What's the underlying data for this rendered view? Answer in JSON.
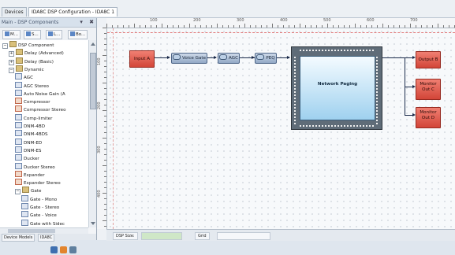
{
  "tabs": [
    {
      "label": "Devices",
      "active": false
    },
    {
      "label": "IDA8C DSP Configuration - IDA8C 1",
      "active": true
    }
  ],
  "left_panel": {
    "title": "Main - DSP Components",
    "controls": [
      "▾",
      "✖"
    ],
    "toolbar": [
      "M...",
      "S...",
      "L...",
      "Bo..."
    ],
    "tree": [
      {
        "label": "DSP Component",
        "indent": 0,
        "exp": "−",
        "icon": "folder"
      },
      {
        "label": "Delay (Advanced)",
        "indent": 1,
        "exp": "+",
        "icon": "folder"
      },
      {
        "label": "Delay (Basic)",
        "indent": 1,
        "exp": "+",
        "icon": "folder"
      },
      {
        "label": "Dynamic",
        "indent": 1,
        "exp": "−",
        "icon": "folder"
      },
      {
        "label": "AGC",
        "indent": 2,
        "exp": "",
        "icon": "compb"
      },
      {
        "label": "AGC Stereo",
        "indent": 2,
        "exp": "",
        "icon": "compb"
      },
      {
        "label": "Auto Noise Gain (A",
        "indent": 2,
        "exp": "",
        "icon": "compb"
      },
      {
        "label": "Compressor",
        "indent": 2,
        "exp": "",
        "icon": "comp"
      },
      {
        "label": "Compressor Stereo",
        "indent": 2,
        "exp": "",
        "icon": "comp"
      },
      {
        "label": "Comp-limiter",
        "indent": 2,
        "exp": "",
        "icon": "compb"
      },
      {
        "label": "DNM-4BD",
        "indent": 2,
        "exp": "",
        "icon": "compb"
      },
      {
        "label": "DNM-4BDS",
        "indent": 2,
        "exp": "",
        "icon": "compb"
      },
      {
        "label": "DNM-ED",
        "indent": 2,
        "exp": "",
        "icon": "compb"
      },
      {
        "label": "DNM-ES",
        "indent": 2,
        "exp": "",
        "icon": "compb"
      },
      {
        "label": "Ducker",
        "indent": 2,
        "exp": "",
        "icon": "compb"
      },
      {
        "label": "Ducker Stereo",
        "indent": 2,
        "exp": "",
        "icon": "compb"
      },
      {
        "label": "Expander",
        "indent": 2,
        "exp": "",
        "icon": "comp"
      },
      {
        "label": "Expander Stereo",
        "indent": 2,
        "exp": "",
        "icon": "comp"
      },
      {
        "label": "Gate",
        "indent": 2,
        "exp": "−",
        "icon": "folder"
      },
      {
        "label": "Gate - Mono",
        "indent": 3,
        "exp": "",
        "icon": "compb"
      },
      {
        "label": "Gate - Stereo",
        "indent": 3,
        "exp": "",
        "icon": "compb"
      },
      {
        "label": "Gate - Voice",
        "indent": 3,
        "exp": "",
        "icon": "compb"
      },
      {
        "label": "Gate with Sidec",
        "indent": 3,
        "exp": "",
        "icon": "compb"
      }
    ],
    "bottom_tabs": [
      "Device Models",
      "IDA8C"
    ]
  },
  "canvas": {
    "ruler_top": [
      "100",
      "200",
      "300",
      "400",
      "500",
      "600",
      "700"
    ],
    "ruler_left": [
      "100",
      "200",
      "300",
      "400"
    ],
    "blocks": {
      "input": "Input A",
      "voice_gate": "Voice Gate",
      "agc": "AGC",
      "peq": "PEQ",
      "paging": "Network Paging",
      "out1": "Output B",
      "out2": "Monitor Out C",
      "out3": "Monitor Out D"
    },
    "status": [
      "DSP Size:",
      "",
      "Grid",
      ""
    ]
  },
  "colors": {
    "io_block": "#d9483b",
    "proc_block": "#a9bcd4",
    "paging_panel": "#aad8f1"
  }
}
